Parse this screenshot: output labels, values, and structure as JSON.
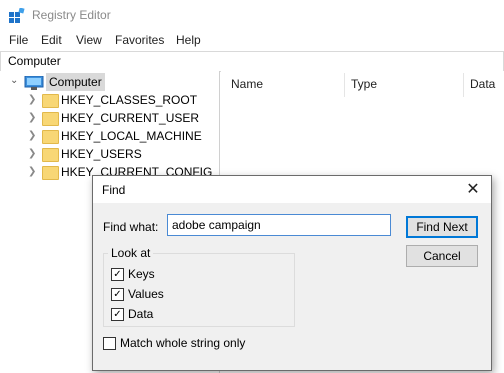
{
  "window": {
    "title": "Registry Editor"
  },
  "menu": [
    "File",
    "Edit",
    "View",
    "Favorites",
    "Help"
  ],
  "address": "Computer",
  "tree": {
    "root": "Computer",
    "items": [
      "HKEY_CLASSES_ROOT",
      "HKEY_CURRENT_USER",
      "HKEY_LOCAL_MACHINE",
      "HKEY_USERS",
      "HKEY_CURRENT_CONFIG"
    ]
  },
  "list": {
    "columns": [
      "Name",
      "Type",
      "Data"
    ]
  },
  "find_dialog": {
    "title": "Find",
    "find_what_label": "Find what:",
    "find_what_value": "adobe campaign",
    "find_next_label": "Find Next",
    "cancel_label": "Cancel",
    "look_at_label": "Look at",
    "options": [
      {
        "label": "Keys",
        "checked": true
      },
      {
        "label": "Values",
        "checked": true
      },
      {
        "label": "Data",
        "checked": true
      }
    ],
    "match_whole_label": "Match whole string only",
    "match_whole_checked": false
  }
}
